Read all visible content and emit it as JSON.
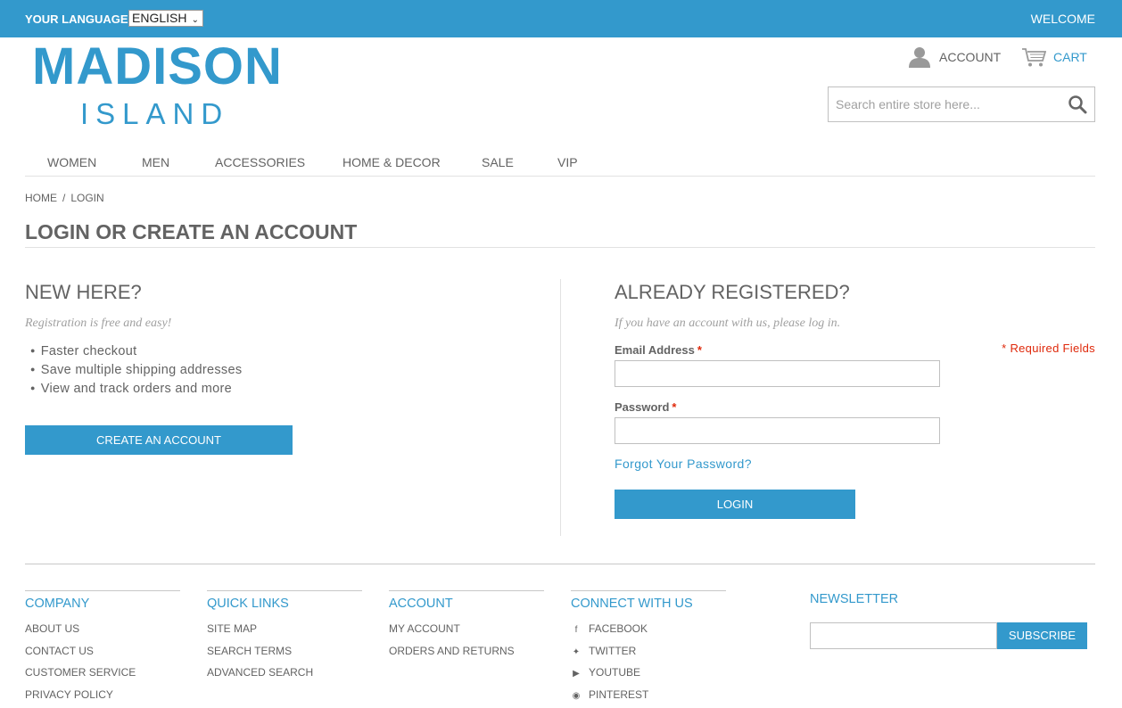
{
  "topbar": {
    "language_label": "YOUR LANGUAGE:",
    "language_selected": "ENGLISH",
    "welcome": "WELCOME"
  },
  "logo": {
    "line1": "MADISON",
    "line2": "ISLAND"
  },
  "header": {
    "account_label": "ACCOUNT",
    "cart_label": "CART",
    "search_placeholder": "Search entire store here..."
  },
  "nav": [
    "WOMEN",
    "MEN",
    "ACCESSORIES",
    "HOME & DECOR",
    "SALE",
    "VIP"
  ],
  "breadcrumb": {
    "home": "HOME",
    "separator": "/",
    "current": "LOGIN"
  },
  "page_title": "LOGIN OR CREATE AN ACCOUNT",
  "new_customer": {
    "title": "NEW HERE?",
    "note": "Registration is free and easy!",
    "benefits": [
      "Faster checkout",
      "Save multiple shipping addresses",
      "View and track orders and more"
    ],
    "button": "CREATE AN ACCOUNT"
  },
  "registered": {
    "title": "ALREADY REGISTERED?",
    "note": "If you have an account with us, please log in.",
    "required_note": "* Required Fields",
    "email_label": "Email Address",
    "password_label": "Password",
    "required_mark": "*",
    "forgot": "Forgot Your Password?",
    "button": "LOGIN"
  },
  "footer": {
    "company": {
      "title": "COMPANY",
      "links": [
        "ABOUT US",
        "CONTACT US",
        "CUSTOMER SERVICE",
        "PRIVACY POLICY"
      ]
    },
    "quick_links": {
      "title": "QUICK LINKS",
      "links": [
        "SITE MAP",
        "SEARCH TERMS",
        "ADVANCED SEARCH"
      ]
    },
    "account": {
      "title": "ACCOUNT",
      "links": [
        "MY ACCOUNT",
        "ORDERS AND RETURNS"
      ]
    },
    "connect": {
      "title": "CONNECT WITH US",
      "links": [
        "FACEBOOK",
        "TWITTER",
        "YOUTUBE",
        "PINTEREST"
      ]
    },
    "newsletter": {
      "title": "NEWSLETTER",
      "button": "SUBSCRIBE"
    }
  },
  "colors": {
    "brand": "#3399cc",
    "required": "#df280a",
    "text": "#636363"
  },
  "icons": [
    "user-icon",
    "cart-icon",
    "search-icon",
    "chevron-down-icon",
    "facebook-icon",
    "twitter-icon",
    "youtube-icon",
    "pinterest-icon"
  ]
}
